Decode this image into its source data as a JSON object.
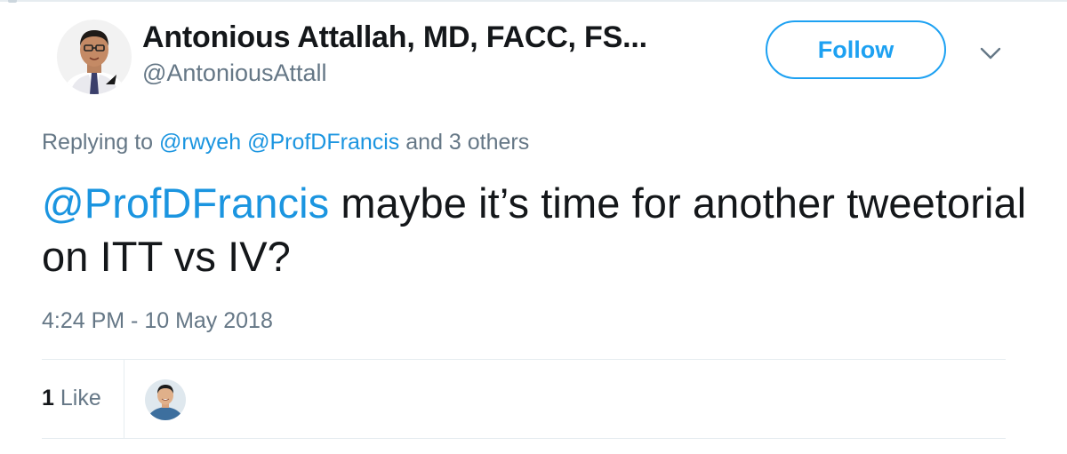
{
  "author": {
    "display_name": "Antonious Attallah, MD, FACC, FS...",
    "handle": "@AntoniousAttall",
    "avatar_icon": "profile-photo"
  },
  "follow_button": {
    "label": "Follow",
    "color": "#1da1f2"
  },
  "menu": {
    "icon": "chevron-down-icon"
  },
  "reply_context": {
    "prefix": "Replying to",
    "mentions": [
      "@rwyeh",
      "@ProfDFrancis"
    ],
    "suffix": "and 3 others"
  },
  "tweet": {
    "mention": "@ProfDFrancis",
    "text": " maybe it’s time for another tweetorial on ITT vs IV?",
    "timestamp": "4:24 PM - 10 May 2018"
  },
  "engagement": {
    "like_count": "1",
    "like_label": "Like",
    "liker_avatar_icon": "profile-photo"
  },
  "colors": {
    "link": "#1b95e0",
    "text": "#14171a",
    "muted": "#657786",
    "divider": "#e6ecf0"
  }
}
